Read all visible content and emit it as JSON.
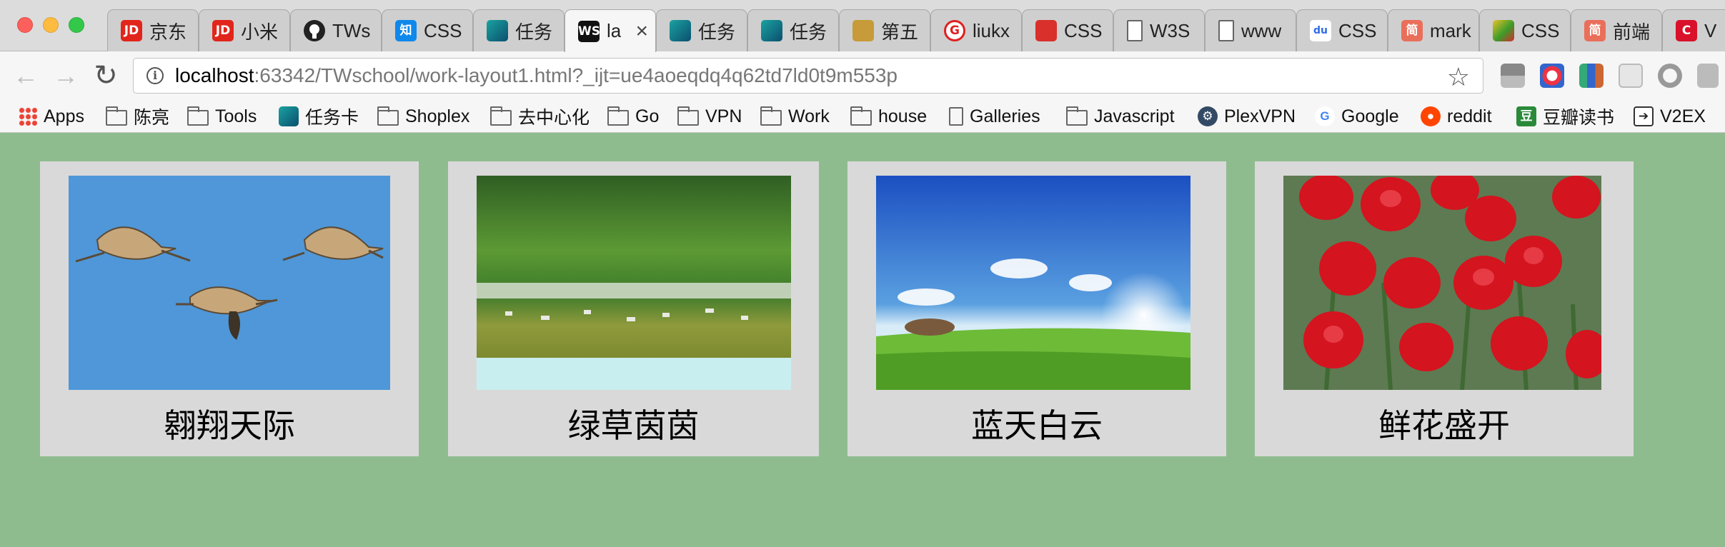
{
  "window": {
    "tabs": [
      {
        "title": "京东",
        "favicon": "JD",
        "color": "#e1251b",
        "active": false
      },
      {
        "title": "小米",
        "favicon": "JD",
        "color": "#e1251b",
        "active": false
      },
      {
        "title": "TWs",
        "favicon": "github-icon",
        "color": "#222222",
        "active": false
      },
      {
        "title": "CSS",
        "favicon": "知",
        "color": "#0f88eb",
        "active": false
      },
      {
        "title": "任务",
        "favicon": "task-icon",
        "color": "#0b6e78",
        "active": false
      },
      {
        "title": "la",
        "favicon": "WS",
        "color": "#111111",
        "active": true
      },
      {
        "title": "任务",
        "favicon": "task-icon",
        "color": "#0b6e78",
        "active": false
      },
      {
        "title": "任务",
        "favicon": "task-icon",
        "color": "#0b6e78",
        "active": false
      },
      {
        "title": "第五",
        "favicon": "avatar-icon",
        "color": "#c79a3a",
        "active": false
      },
      {
        "title": "liukx",
        "favicon": "G",
        "color": "#e02020",
        "active": false
      },
      {
        "title": "CSS",
        "favicon": "shield-icon",
        "color": "#d9302c",
        "active": false
      },
      {
        "title": "W3S",
        "favicon": "page-icon",
        "color": "#ffffff",
        "active": false
      },
      {
        "title": "www",
        "favicon": "page-icon",
        "color": "#ffffff",
        "active": false
      },
      {
        "title": "CSS",
        "favicon": "baidu-icon",
        "color": "#2e6de6",
        "active": false
      },
      {
        "title": "mark",
        "favicon": "简",
        "color": "#ea6f5a",
        "active": false
      },
      {
        "title": "CSS",
        "favicon": "windmill-icon",
        "color": "#3c9b2a",
        "active": false
      },
      {
        "title": "前端",
        "favicon": "简",
        "color": "#ea6f5a",
        "active": false
      },
      {
        "title": "V",
        "favicon": "C",
        "color": "#d9112a",
        "active": false
      }
    ]
  },
  "toolbar": {
    "url_host": "localhost",
    "url_rest": ":63342/TWschool/work-layout1.html?_ijt=ue4aoeqdq4q62td7ld0t9m553p"
  },
  "bookmarks": [
    {
      "label": "Apps",
      "icon": "apps-icon"
    },
    {
      "label": "陈亮",
      "icon": "folder-icon"
    },
    {
      "label": "Tools",
      "icon": "folder-icon"
    },
    {
      "label": "任务卡",
      "icon": "task-icon"
    },
    {
      "label": "Shoplex",
      "icon": "folder-icon"
    },
    {
      "label": "去中心化",
      "icon": "folder-icon"
    },
    {
      "label": "Go",
      "icon": "folder-icon"
    },
    {
      "label": "VPN",
      "icon": "folder-icon"
    },
    {
      "label": "Work",
      "icon": "folder-icon"
    },
    {
      "label": "house",
      "icon": "folder-icon"
    },
    {
      "label": "Galleries",
      "icon": "page-icon"
    },
    {
      "label": "Javascript",
      "icon": "folder-icon"
    },
    {
      "label": "PlexVPN",
      "icon": "plexvpn-icon"
    },
    {
      "label": "Google",
      "icon": "google-icon"
    },
    {
      "label": "reddit",
      "icon": "reddit-icon"
    },
    {
      "label": "豆瓣读书",
      "icon": "douban-icon"
    },
    {
      "label": "V2EX",
      "icon": "v2ex-icon"
    }
  ],
  "gallery": [
    {
      "caption": "翱翔天际",
      "image": "flying-cranes-image"
    },
    {
      "caption": "绿草茵茵",
      "image": "grassland-image"
    },
    {
      "caption": "蓝天白云",
      "image": "blue-sky-image"
    },
    {
      "caption": "鲜花盛开",
      "image": "tulips-image"
    }
  ],
  "colors": {
    "page_background": "#8fbc8f",
    "card_background": "#d9d9d9"
  }
}
